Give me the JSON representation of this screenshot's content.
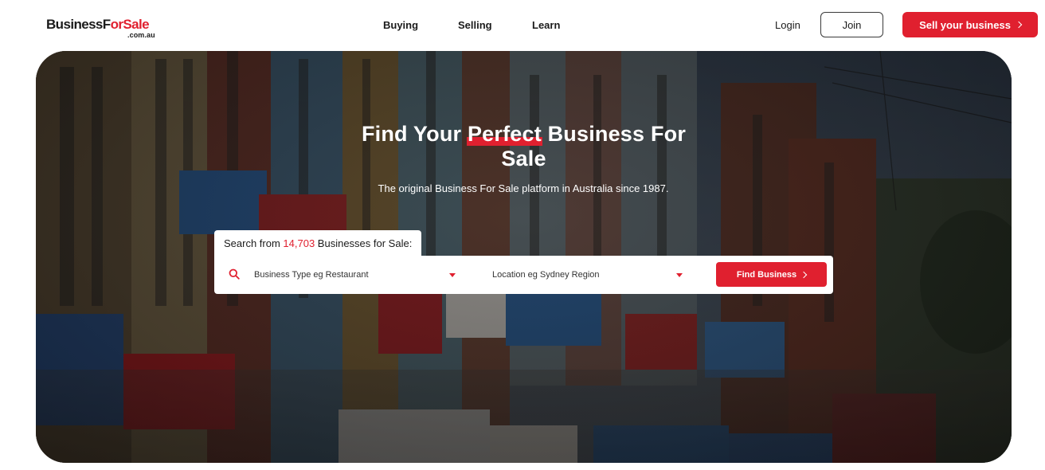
{
  "header": {
    "logo": {
      "main_prefix": "BusinessF",
      "main_o": "o",
      "main_accent": "rSale",
      "sub": ".com.au"
    },
    "nav": [
      {
        "label": "Buying"
      },
      {
        "label": "Selling"
      },
      {
        "label": "Learn"
      }
    ],
    "login_label": "Login",
    "join_label": "Join",
    "sell_label": "Sell your business"
  },
  "hero": {
    "headline_before": "Find Your ",
    "headline_highlight": "Perfect",
    "headline_after": " Business For Sale",
    "subtitle": "The original Business For Sale platform in Australia since 1987.",
    "search_prefix": "Search from ",
    "business_count": "14,703",
    "search_suffix": " Businesses for Sale:",
    "business_type_placeholder": "Business Type eg Restaurant",
    "location_placeholder": "Location eg Sydney Region",
    "find_label": "Find Business"
  },
  "colors": {
    "brand_red": "#e0202f",
    "text_dark": "#1b1b1b"
  },
  "icons": {
    "search": "search-icon",
    "dropdown": "caret-down-icon",
    "chevron": "chevron-right-icon"
  }
}
